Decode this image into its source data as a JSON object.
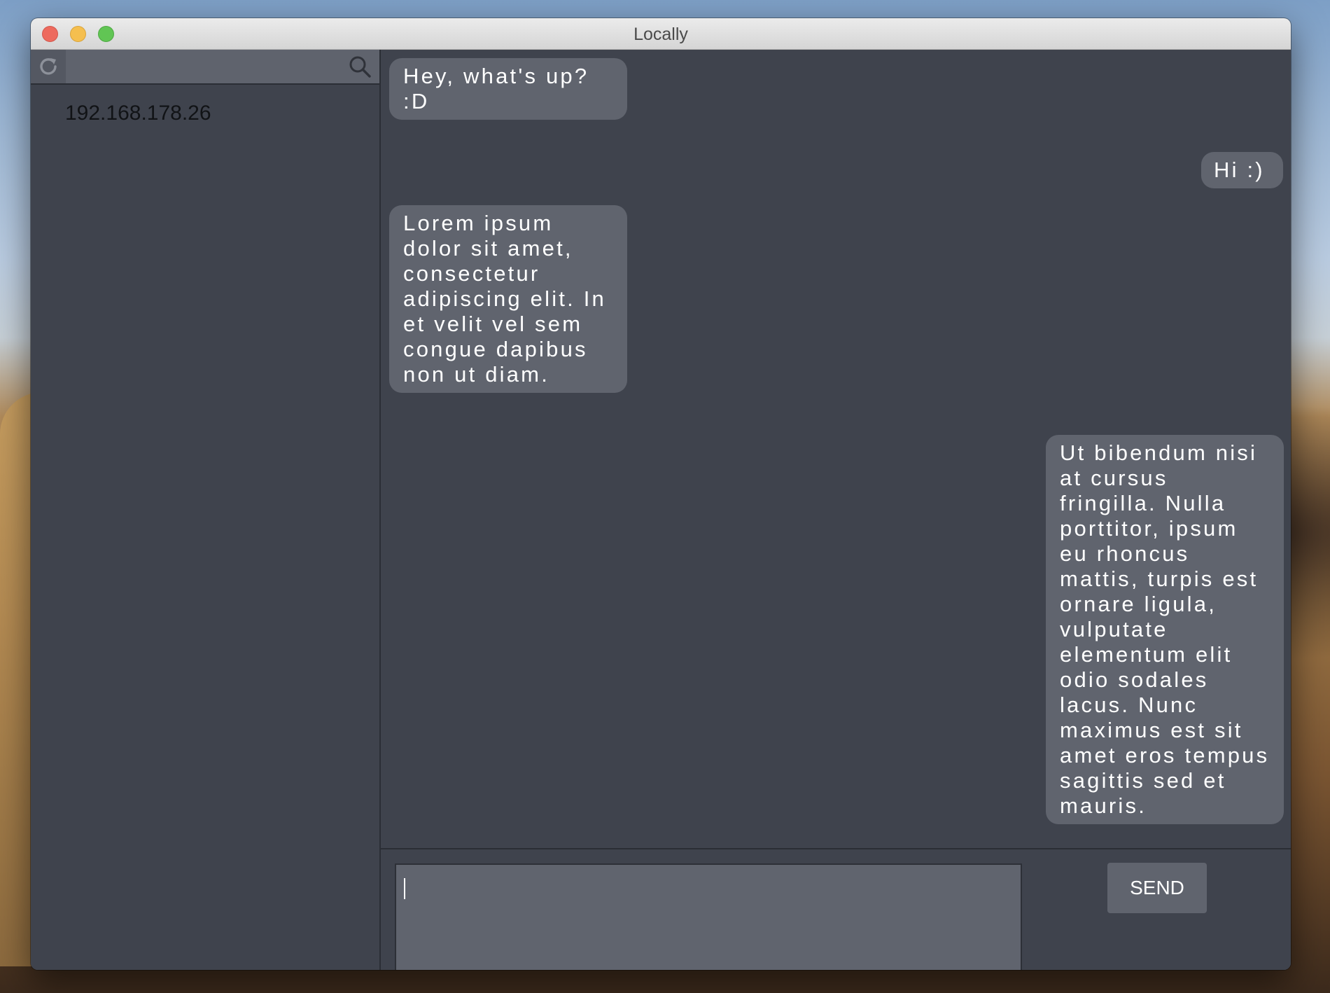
{
  "window": {
    "title": "Locally"
  },
  "sidebar": {
    "search": {
      "value": "",
      "placeholder": ""
    },
    "peers": [
      {
        "address": "192.168.178.26"
      }
    ]
  },
  "chat": {
    "messages": [
      {
        "side": "received",
        "text": "Hey, what's up? :D"
      },
      {
        "side": "sent",
        "text": "Hi :)"
      },
      {
        "side": "received",
        "text": "Lorem ipsum dolor sit amet, consectetur adipiscing elit. In et velit vel sem congue dapibus non ut diam."
      },
      {
        "side": "sent",
        "text": "Ut bibendum nisi at cursus fringilla. Nulla porttitor, ipsum eu rhoncus mattis, turpis est ornare ligula, vulputate elementum elit odio sodales lacus. Nunc maximus est sit amet eros tempus sagittis sed et mauris."
      }
    ]
  },
  "composer": {
    "value": "",
    "send_label": "SEND"
  },
  "colors": {
    "window_bg": "#3f434d",
    "bubble_bg": "#60646e",
    "toolbar_bg": "#5f636d",
    "close": "#ed6a5e",
    "minimize": "#f5bf4f",
    "maximize": "#61c554"
  },
  "icons": {
    "refresh": "refresh-icon",
    "search": "search-icon"
  }
}
